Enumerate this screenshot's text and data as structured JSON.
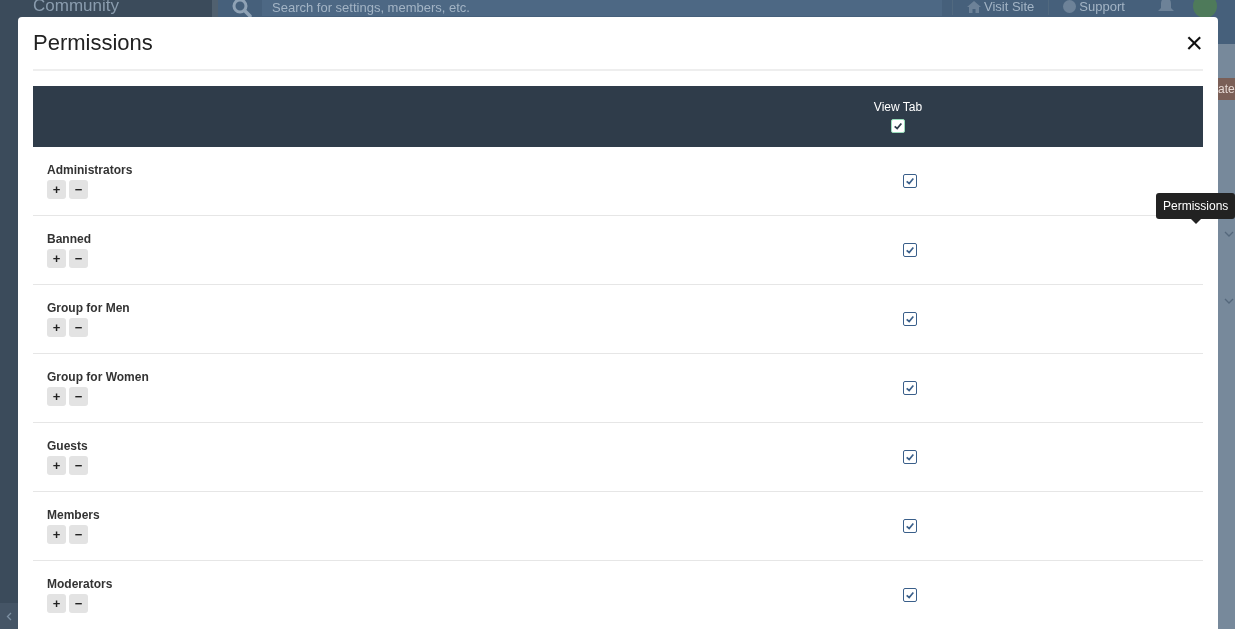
{
  "background": {
    "brand": "Community",
    "search": {
      "placeholder": "Search for settings, members, etc."
    },
    "nav_links": [
      "Visit Site",
      "Support"
    ],
    "button_fragment": "ate"
  },
  "modal": {
    "title": "Permissions",
    "close": "×"
  },
  "table": {
    "columns": [
      {
        "label": "View Tab",
        "checked": true
      }
    ],
    "rows": [
      {
        "name": "Administrators",
        "add": "+",
        "remove": "−",
        "checked": [
          true
        ]
      },
      {
        "name": "Banned",
        "add": "+",
        "remove": "−",
        "checked": [
          true
        ]
      },
      {
        "name": "Group for Men",
        "add": "+",
        "remove": "−",
        "checked": [
          true
        ]
      },
      {
        "name": "Group for Women",
        "add": "+",
        "remove": "−",
        "checked": [
          true
        ]
      },
      {
        "name": "Guests",
        "add": "+",
        "remove": "−",
        "checked": [
          true
        ]
      },
      {
        "name": "Members",
        "add": "+",
        "remove": "−",
        "checked": [
          true
        ]
      },
      {
        "name": "Moderators",
        "add": "+",
        "remove": "−",
        "checked": [
          true
        ]
      }
    ]
  },
  "tooltip": {
    "text": "Permissions"
  }
}
